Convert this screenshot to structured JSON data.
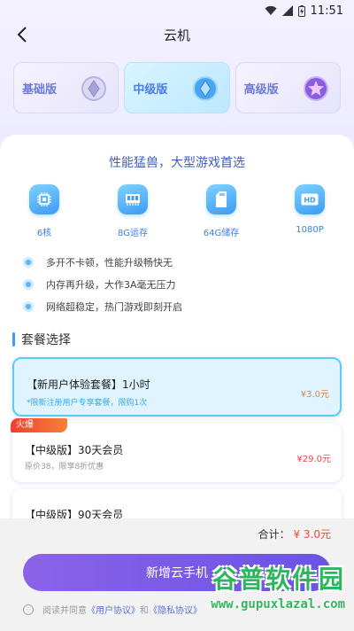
{
  "status_bar": {
    "time": "11:51"
  },
  "header": {
    "title": "云机"
  },
  "tabs": [
    {
      "label": "基础版",
      "active": false
    },
    {
      "label": "中级版",
      "active": true
    },
    {
      "label": "高级版",
      "active": false
    }
  ],
  "slogan": "性能猛兽，大型游戏首选",
  "specs": [
    {
      "label": "6核",
      "icon": "cpu-chip-icon"
    },
    {
      "label": "8G运存",
      "icon": "memory-icon"
    },
    {
      "label": "64G储存",
      "icon": "storage-card-icon"
    },
    {
      "label": "1080P",
      "icon": "hd-icon"
    }
  ],
  "features": [
    "多开不卡顿，性能升级畅快无",
    "内存再升级，大作3A毫无压力",
    "网络超稳定，热门游戏即刻开启"
  ],
  "section_title": "套餐选择",
  "packages": [
    {
      "name": "【新用户体验套餐】1小时",
      "sub": "*限新注册用户专享套餐，限购1次",
      "price": "¥3.0元",
      "selected": true
    },
    {
      "name": "【中级版】30天会员",
      "sub": "原价38，限享8折优惠",
      "price": "¥29.0元",
      "selected": false,
      "badge": "火爆"
    },
    {
      "name": "【中级版】90天会员",
      "sub": "",
      "price": "",
      "selected": false
    }
  ],
  "total": {
    "label": "合计：",
    "value": "¥ 3.0元"
  },
  "main_button": "新增云手机",
  "agreement": {
    "prefix": "阅读并同意",
    "user_agreement": "《用户协议》",
    "and": "和",
    "privacy": "《隐私协议》"
  },
  "watermark": {
    "title": "谷普软件园",
    "url": "www.gupuxlazal.com"
  },
  "colors": {
    "accent": "#3b9cf5",
    "button": "#7a5be6",
    "price": "#e74a4a"
  }
}
